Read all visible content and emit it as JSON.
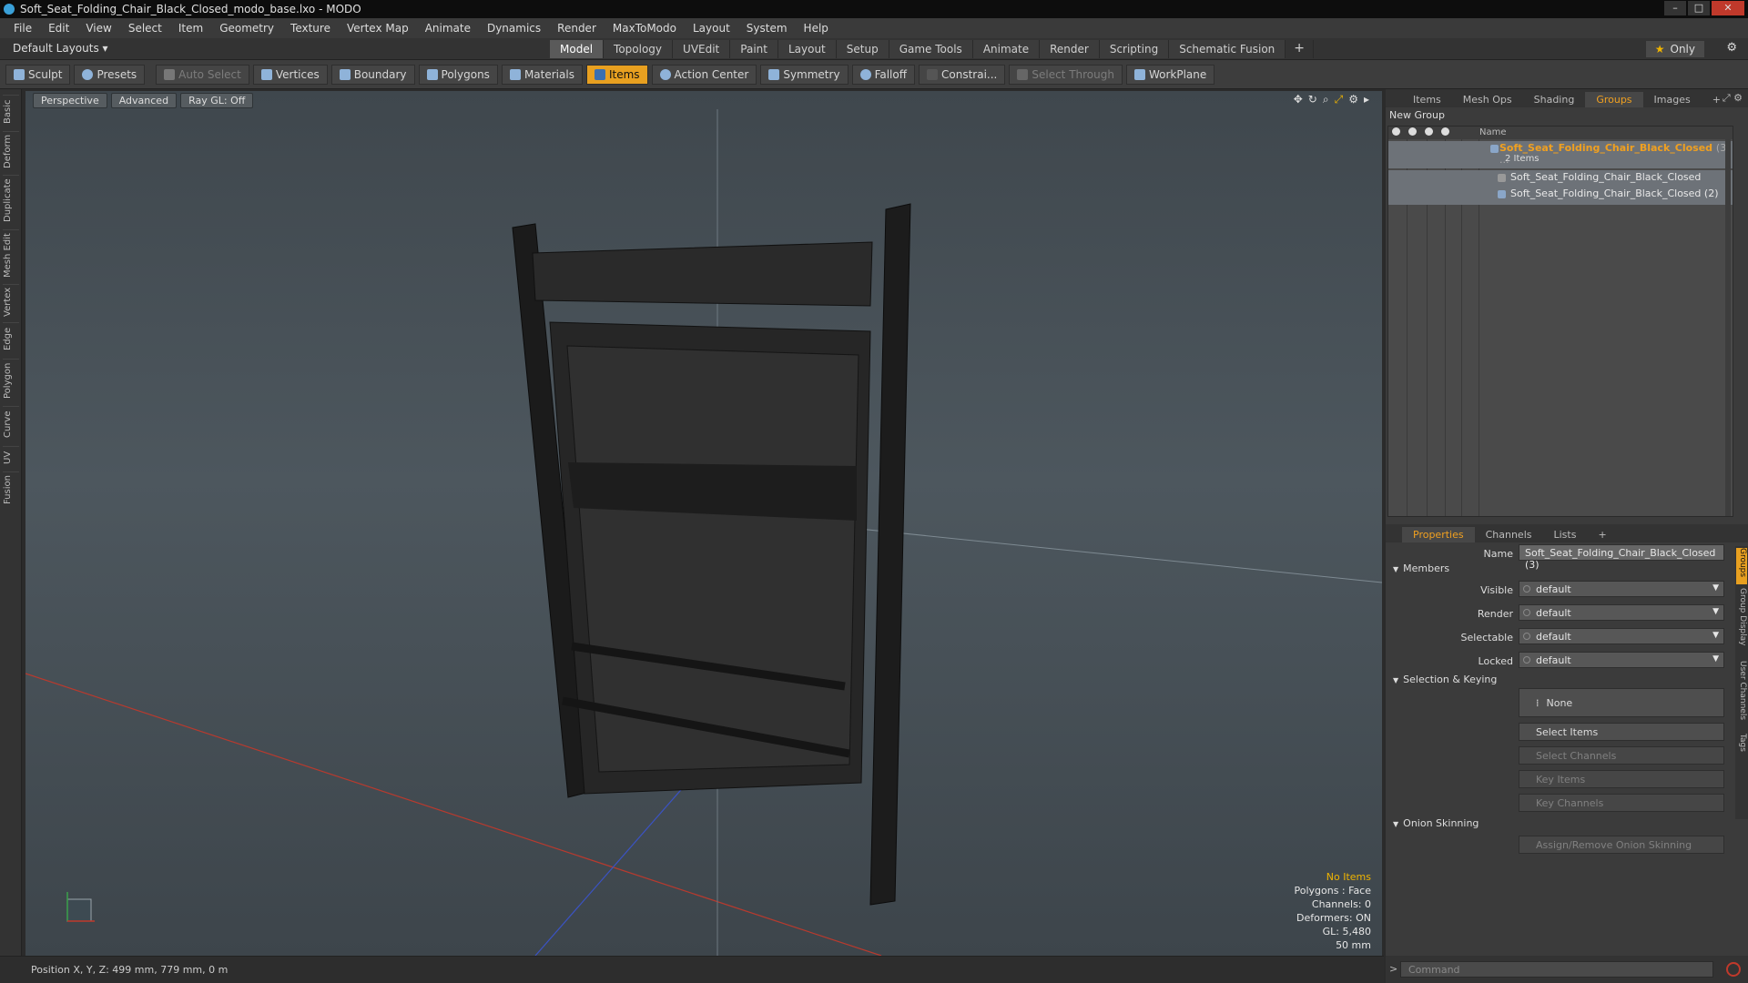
{
  "window": {
    "title": "Soft_Seat_Folding_Chair_Black_Closed_modo_base.lxo - MODO"
  },
  "menu": [
    "File",
    "Edit",
    "View",
    "Select",
    "Item",
    "Geometry",
    "Texture",
    "Vertex Map",
    "Animate",
    "Dynamics",
    "Render",
    "MaxToModo",
    "Layout",
    "System",
    "Help"
  ],
  "layouts": {
    "dropdown": "Default Layouts",
    "only_label": "Only",
    "tabs": [
      "Model",
      "Topology",
      "UVEdit",
      "Paint",
      "Layout",
      "Setup",
      "Game Tools",
      "Animate",
      "Render",
      "Scripting",
      "Schematic Fusion"
    ],
    "active": "Model",
    "plus": "+"
  },
  "toolbar": {
    "sculpt": "Sculpt",
    "presets": "Presets",
    "auto_select": "Auto Select",
    "vertices": "Vertices",
    "boundary": "Boundary",
    "polygons": "Polygons",
    "materials": "Materials",
    "items": "Items",
    "action_center": "Action Center",
    "symmetry": "Symmetry",
    "falloff": "Falloff",
    "constraints": "Constrai...",
    "select_through": "Select Through",
    "workplane": "WorkPlane"
  },
  "left_tabs": [
    "Basic",
    "Deform",
    "Duplicate",
    "Mesh Edit",
    "Vertex",
    "Edge",
    "Polygon",
    "Curve",
    "UV",
    "Fusion"
  ],
  "viewport": {
    "perspective": "Perspective",
    "advanced": "Advanced",
    "raygl": "Ray GL: Off",
    "stats": {
      "items": "No Items",
      "polygons": "Polygons : Face",
      "channels": "Channels: 0",
      "deformers": "Deformers: ON",
      "gl": "GL: 5,480",
      "scale": "50 mm"
    }
  },
  "status": {
    "position": "Position X, Y, Z:  499 mm, 779 mm, 0 m"
  },
  "groups_panel": {
    "tabs": [
      "Items",
      "Mesh Ops",
      "Shading",
      "Groups",
      "Images"
    ],
    "active": "Groups",
    "plus": "+",
    "new_group": "New Group",
    "col_name": "Name",
    "group": {
      "name": "Soft_Seat_Folding_Chair_Black_Closed",
      "suffix": "(3 ...",
      "count": "2 Items"
    },
    "children": [
      "Soft_Seat_Folding_Chair_Black_Closed",
      "Soft_Seat_Folding_Chair_Black_Closed (2)"
    ]
  },
  "properties": {
    "tabs": [
      "Properties",
      "Channels",
      "Lists"
    ],
    "active": "Properties",
    "plus": "+",
    "name_label": "Name",
    "name_value": "Soft_Seat_Folding_Chair_Black_Closed (3)",
    "members": "Members",
    "rows": [
      {
        "label": "Visible",
        "value": "default"
      },
      {
        "label": "Render",
        "value": "default"
      },
      {
        "label": "Selectable",
        "value": "default"
      },
      {
        "label": "Locked",
        "value": "default"
      }
    ],
    "sel_keying": "Selection & Keying",
    "none": "None",
    "select_items": "Select Items",
    "select_channels": "Select Channels",
    "key_items": "Key Items",
    "key_channels": "Key Channels",
    "onion": "Onion Skinning",
    "assign_onion": "Assign/Remove Onion Skinning",
    "side_tabs": [
      "Groups",
      "Group Display",
      "User Channels",
      "Tags"
    ]
  },
  "command": {
    "placeholder": "Command",
    "prompt": ">"
  },
  "colors": {
    "accent": "#e8a020",
    "background": "#3b3b3b"
  }
}
